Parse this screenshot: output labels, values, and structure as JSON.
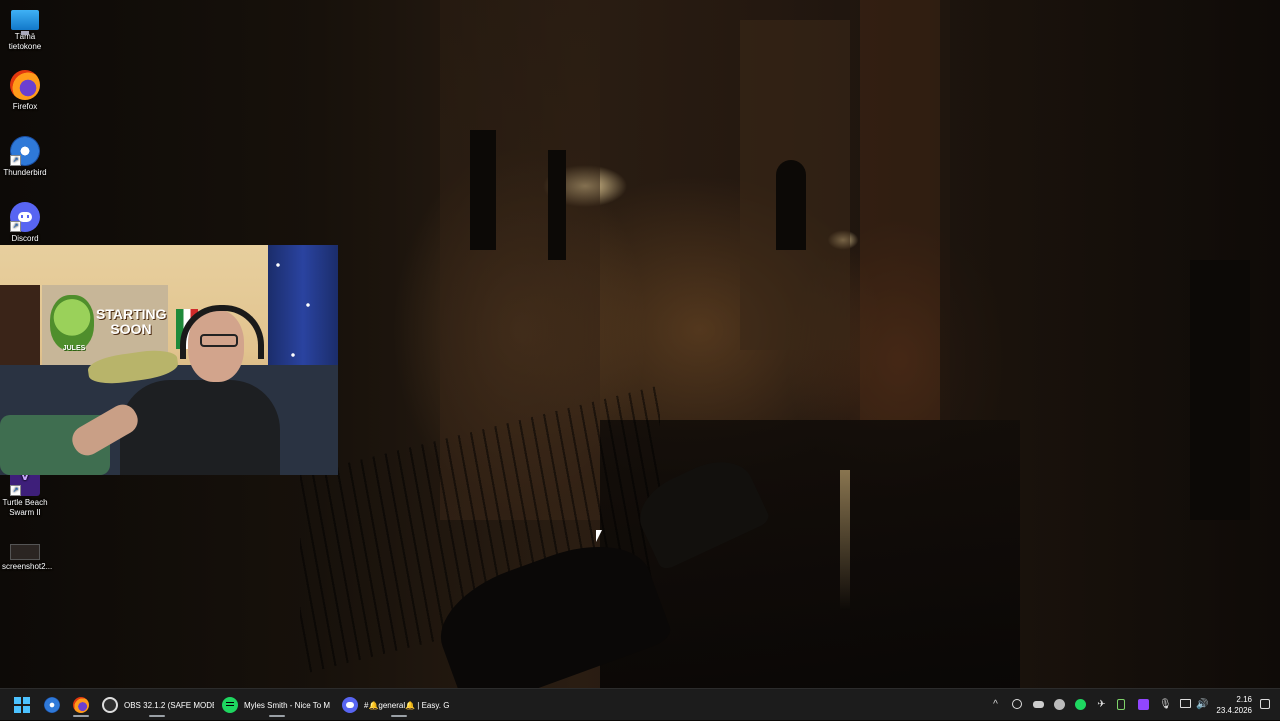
{
  "desktop": {
    "icons": [
      {
        "label": "Tämä tietokone",
        "icon": "this-pc-icon"
      },
      {
        "label": "Firefox",
        "icon": "firefox-icon"
      },
      {
        "label": "Thunderbird",
        "icon": "thunderbird-icon"
      },
      {
        "label": "Discord",
        "icon": "discord-icon"
      },
      {
        "label": "Turtle Beach Swarm II",
        "icon": "turtle-beach-icon"
      },
      {
        "label": "screenshot2...",
        "icon": "image-file-icon"
      }
    ]
  },
  "webcam": {
    "poster_text": "STARTING SOON",
    "turtle_label": "JULES"
  },
  "taskbar": {
    "start": {
      "icon": "windows-start-icon"
    },
    "pinned": [
      {
        "icon": "thunderbird-icon"
      },
      {
        "icon": "firefox-icon"
      }
    ],
    "apps": [
      {
        "label": "OBS 32.1.2 (SAFE MODE",
        "icon": "obs-icon"
      },
      {
        "label": "Myles Smith - Nice To M",
        "icon": "spotify-icon"
      },
      {
        "label": "#🔔general🔔 | Easy. G",
        "icon": "discord-icon"
      }
    ],
    "tray": {
      "chevron": "^",
      "icons": [
        "obs-tray-icon",
        "discord-tray-icon",
        "steam-tray-icon",
        "spotify-tray-icon",
        "tray-app-icon",
        "battery-icon",
        "twitch-tray-icon",
        "microphone-icon",
        "network-icon",
        "volume-icon"
      ],
      "time": "2.16",
      "date": "23.4.2026"
    },
    "colors": {
      "background": "#1c1c1c",
      "accent": "#4cc2ff"
    }
  }
}
